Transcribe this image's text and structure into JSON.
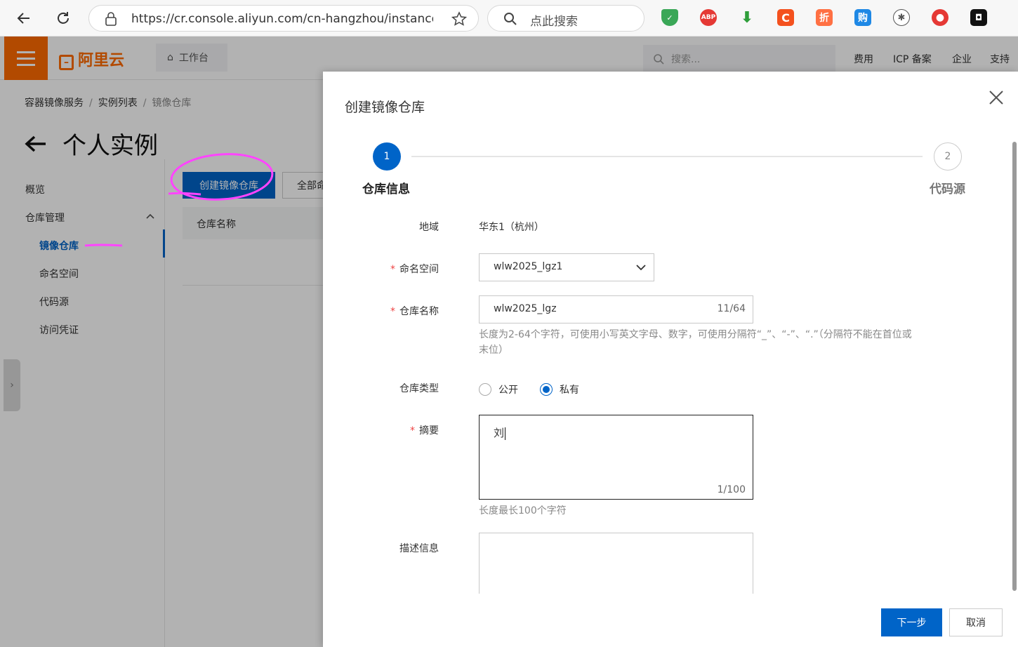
{
  "browser": {
    "url": "https://cr.console.aliyun.com/cn-hangzhou/instance/r...",
    "search_placeholder": "点此搜索",
    "extensions": [
      "shield-icon",
      "abp-icon",
      "download-icon",
      "c-icon",
      "discount-icon",
      "shop-icon",
      "fan-icon",
      "record-icon",
      "tab-icon"
    ]
  },
  "console": {
    "logo": "阿里云",
    "workbench": "工作台",
    "search_placeholder": "搜索...",
    "top_links": [
      "费用",
      "ICP 备案",
      "企业",
      "支持"
    ],
    "breadcrumb": [
      "容器镜像服务",
      "实例列表",
      "镜像仓库"
    ],
    "page_title": "个人实例",
    "sidebar": {
      "overview": "概览",
      "group": "仓库管理",
      "items": [
        "镜像仓库",
        "命名空间",
        "代码源",
        "访问凭证"
      ]
    },
    "create_button": "创建镜像仓库",
    "filter_button": "全部命名空间",
    "table_header": "仓库名称"
  },
  "drawer": {
    "title": "创建镜像仓库",
    "steps": [
      {
        "num": "1",
        "label": "仓库信息"
      },
      {
        "num": "2",
        "label": "代码源"
      }
    ],
    "region_label": "地域",
    "region_value": "华东1（杭州）",
    "namespace_label": "命名空间",
    "namespace_value": "wlw2025_lgz1",
    "repo_name_label": "仓库名称",
    "repo_name_value": "wlw2025_lgz",
    "repo_name_counter": "11/64",
    "repo_name_hint_line1": "长度为2-64个字符，可使用小写英文字母、数字，可使用分隔符“_”、“-”、“.”（分隔符不能在首位或",
    "repo_name_hint_line2": "末位）",
    "type_label": "仓库类型",
    "type_options": [
      "公开",
      "私有"
    ],
    "type_selected": "私有",
    "summary_label": "摘要",
    "summary_value": "刘",
    "summary_counter": "1/100",
    "summary_hint": "长度最长100个字符",
    "description_label": "描述信息",
    "description_value": "",
    "next_button": "下一步",
    "cancel_button": "取消"
  },
  "colors": {
    "primary": "#0064c8",
    "brand": "#ff6a00",
    "annotation": "#ff44ff"
  }
}
